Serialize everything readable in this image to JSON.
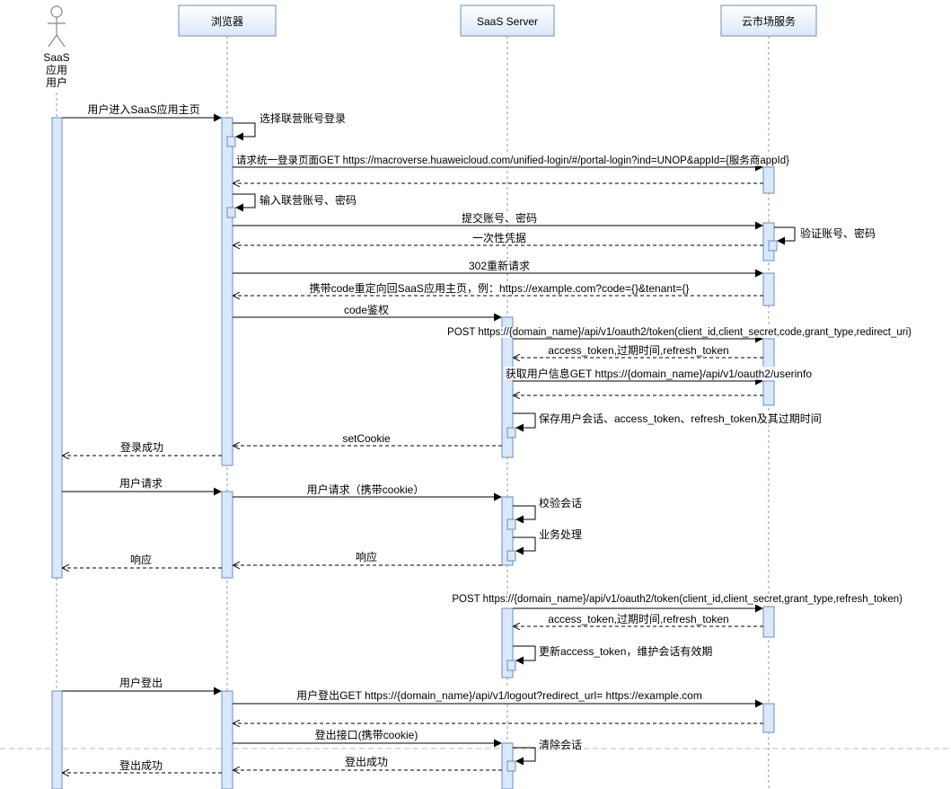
{
  "actor": {
    "line1": "SaaS",
    "line2": "应用",
    "line3": "用户"
  },
  "participants": {
    "browser": "浏览器",
    "server": "SaaS Server",
    "cloud": "云市场服务"
  },
  "messages": {
    "m1": "用户进入SaaS应用主页",
    "m2": "选择联营账号登录",
    "m3": "请求统一登录页面GET https://macroverse.huaweicloud.com/unified-login/#/portal-login?ind=UNOP&appId={服务商appId}",
    "m4": "输入联营账号、密码",
    "m5": "提交账号、密码",
    "m6": "验证账号、密码",
    "m7": "一次性凭据",
    "m8": "302重新请求",
    "m9": "携带code重定向回SaaS应用主页，例：https://example.com?code={}&tenant={}",
    "m10": "code鉴权",
    "m11": "POST https://{domain_name}/api/v1/oauth2/token(client_id,client_secret,code,grant_type,redirect_uri)",
    "m12": "access_token,过期时间,refresh_token",
    "m13": "获取用户信息GET https://{domain_name}/api/v1/oauth2/userinfo",
    "m14": "保存用户会话、access_token、refresh_token及其过期时间",
    "m15": "setCookie",
    "m16": "登录成功",
    "m17": "用户请求",
    "m18": "用户请求（携带cookie）",
    "m19": "校验会话",
    "m20": "业务处理",
    "m21": "响应",
    "m22": "响应",
    "m23": "POST https://{domain_name}/api/v1/oauth2/token(client_id,client_secret,grant_type,refresh_token)",
    "m24": "access_token,过期时间,refresh_token",
    "m25": "更新access_token，维护会话有效期",
    "m26": "用户登出",
    "m27": "用户登出GET https://{domain_name}/api/v1/logout?redirect_url= https://example.com",
    "m28": "登出接口(携带cookie)",
    "m29": "清除会话",
    "m30": "登出成功",
    "m31": "登出成功"
  },
  "colors": {
    "box_fill": "#dae8fc",
    "box_stroke": "#6c8ebf",
    "line": "#000000",
    "lifeline": "#999999"
  }
}
